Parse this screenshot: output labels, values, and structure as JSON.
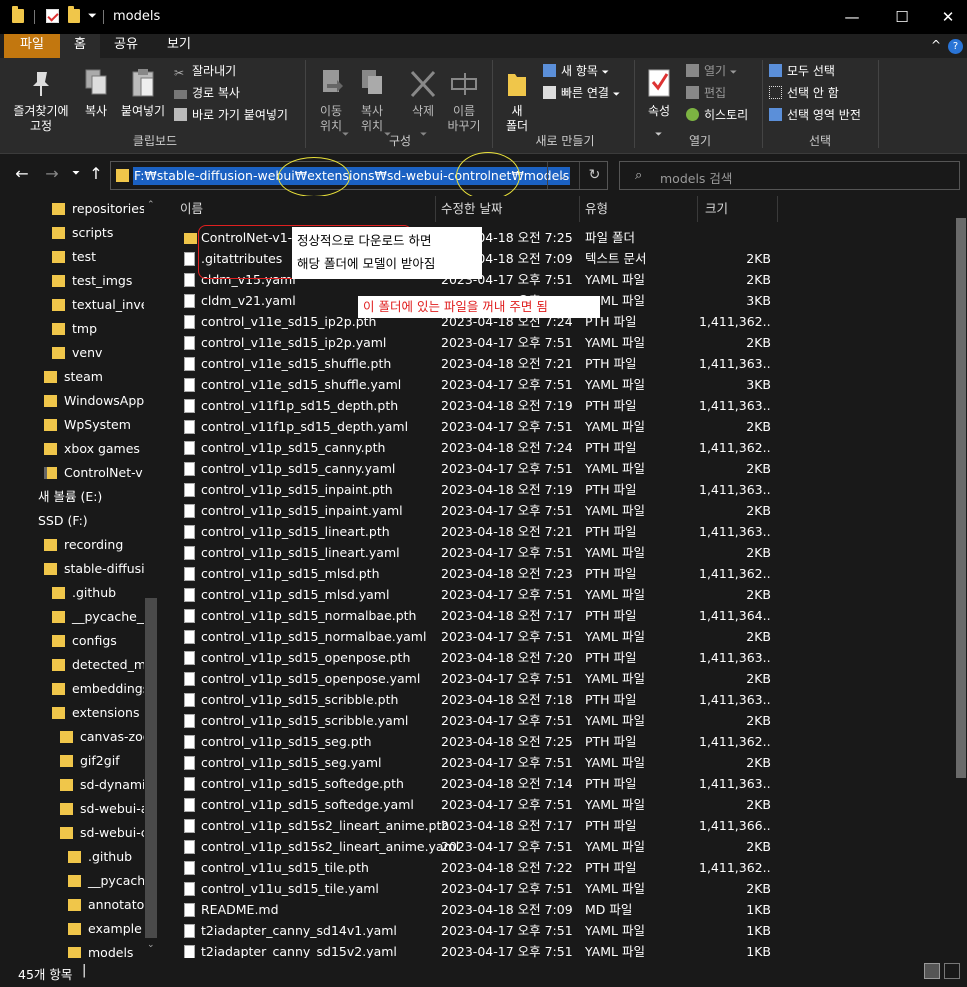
{
  "window": {
    "title": "models",
    "minimize": "—",
    "maximize": "☐",
    "close": "✕"
  },
  "menu": {
    "file": "파일",
    "home": "홈",
    "share": "공유",
    "view": "보기",
    "collapse": "^",
    "help": "?"
  },
  "ribbon": {
    "clipboard": {
      "pin": "즐겨찾기에\n고정",
      "copy": "복사",
      "paste": "붙여넣기",
      "cut": "잘라내기",
      "copy_path": "경로 복사",
      "paste_shortcut": "바로 가기 붙여넣기",
      "label": "클립보드"
    },
    "organize": {
      "move": "이동\n위치",
      "copy_to": "복사\n위치",
      "delete": "삭제",
      "rename": "이름\n바꾸기",
      "label": "구성"
    },
    "new": {
      "new_folder": "새\n폴더",
      "new_item": "새 항목",
      "easy_access": "빠른 연결",
      "label": "새로 만들기"
    },
    "open": {
      "properties": "속성",
      "open": "열기",
      "edit": "편집",
      "history": "히스토리",
      "label": "열기"
    },
    "select": {
      "select_all": "모두 선택",
      "select_none": "선택 안 함",
      "invert": "선택 영역 반전",
      "label": "선택"
    }
  },
  "address": {
    "path": "F:₩stable-diffusion-webui₩extensions₩sd-webui-controlnet₩models",
    "search_placeholder": "models 검색"
  },
  "sidebar": [
    {
      "label": "repositories",
      "icon": "folder-icon"
    },
    {
      "label": "scripts",
      "icon": "folder-icon"
    },
    {
      "label": "test",
      "icon": "folder-icon"
    },
    {
      "label": "test_imgs",
      "icon": "folder-icon"
    },
    {
      "label": "textual_inversion",
      "icon": "folder-icon"
    },
    {
      "label": "tmp",
      "icon": "folder-icon"
    },
    {
      "label": "venv",
      "icon": "folder-icon"
    },
    {
      "label": "steam",
      "icon": "folder-icon"
    },
    {
      "label": "WindowsApps",
      "icon": "folder-icon"
    },
    {
      "label": "WpSystem",
      "icon": "folder-icon"
    },
    {
      "label": "xbox games",
      "icon": "folder-icon"
    },
    {
      "label": "ControlNet-v1-1",
      "icon": "zip-folder-icon"
    },
    {
      "label": "새 볼륨 (E:)",
      "icon": "drive-icon"
    },
    {
      "label": "SSD (F:)",
      "icon": "drive-icon"
    },
    {
      "label": "recording",
      "icon": "folder-icon"
    },
    {
      "label": "stable-diffusion-webui",
      "icon": "folder-icon"
    },
    {
      "label": ".github",
      "icon": "folder-icon"
    },
    {
      "label": "__pycache__",
      "icon": "folder-icon"
    },
    {
      "label": "configs",
      "icon": "folder-icon"
    },
    {
      "label": "detected_maps",
      "icon": "folder-icon"
    },
    {
      "label": "embeddings",
      "icon": "folder-icon"
    },
    {
      "label": "extensions",
      "icon": "folder-icon"
    },
    {
      "label": "canvas-zoom",
      "icon": "folder-icon"
    },
    {
      "label": "gif2gif",
      "icon": "folder-icon"
    },
    {
      "label": "sd-dynamic-prompts",
      "icon": "folder-icon"
    },
    {
      "label": "sd-webui-additional-networks",
      "icon": "folder-icon"
    },
    {
      "label": "sd-webui-controlnet",
      "icon": "folder-icon"
    },
    {
      "label": ".github",
      "icon": "folder-icon"
    },
    {
      "label": "__pycache__",
      "icon": "folder-icon"
    },
    {
      "label": "annotator",
      "icon": "folder-icon"
    },
    {
      "label": "example",
      "icon": "folder-icon"
    },
    {
      "label": "models",
      "icon": "folder-icon"
    }
  ],
  "columns": {
    "name": "이름",
    "date": "수정한 날짜",
    "type": "유형",
    "size": "크기"
  },
  "files": [
    {
      "name": "ControlNet-v1-1",
      "date": "2023-04-18 오전 7:25",
      "type": "파일 폴더",
      "size": "",
      "icon": "folder-icon"
    },
    {
      "name": ".gitattributes",
      "date": "2023-04-18 오전 7:09",
      "type": "텍스트 문서",
      "size": "2KB",
      "icon": "file-icon"
    },
    {
      "name": "cldm_v15.yaml",
      "date": "2023-04-17 오후 7:51",
      "type": "YAML 파일",
      "size": "2KB",
      "icon": "file-icon"
    },
    {
      "name": "cldm_v21.yaml",
      "date": "2023-04-17 오후 7:51",
      "type": "YAML 파일",
      "size": "3KB",
      "icon": "file-icon"
    },
    {
      "name": "control_v11e_sd15_ip2p.pth",
      "date": "2023-04-18 오전 7:24",
      "type": "PTH 파일",
      "size": "1,411,362...",
      "icon": "file-icon"
    },
    {
      "name": "control_v11e_sd15_ip2p.yaml",
      "date": "2023-04-17 오후 7:51",
      "type": "YAML 파일",
      "size": "2KB",
      "icon": "file-icon"
    },
    {
      "name": "control_v11e_sd15_shuffle.pth",
      "date": "2023-04-18 오전 7:21",
      "type": "PTH 파일",
      "size": "1,411,363...",
      "icon": "file-icon"
    },
    {
      "name": "control_v11e_sd15_shuffle.yaml",
      "date": "2023-04-17 오후 7:51",
      "type": "YAML 파일",
      "size": "3KB",
      "icon": "file-icon"
    },
    {
      "name": "control_v11f1p_sd15_depth.pth",
      "date": "2023-04-18 오전 7:19",
      "type": "PTH 파일",
      "size": "1,411,363...",
      "icon": "file-icon"
    },
    {
      "name": "control_v11f1p_sd15_depth.yaml",
      "date": "2023-04-17 오후 7:51",
      "type": "YAML 파일",
      "size": "2KB",
      "icon": "file-icon"
    },
    {
      "name": "control_v11p_sd15_canny.pth",
      "date": "2023-04-18 오전 7:24",
      "type": "PTH 파일",
      "size": "1,411,362...",
      "icon": "file-icon"
    },
    {
      "name": "control_v11p_sd15_canny.yaml",
      "date": "2023-04-17 오후 7:51",
      "type": "YAML 파일",
      "size": "2KB",
      "icon": "file-icon"
    },
    {
      "name": "control_v11p_sd15_inpaint.pth",
      "date": "2023-04-18 오전 7:19",
      "type": "PTH 파일",
      "size": "1,411,363...",
      "icon": "file-icon"
    },
    {
      "name": "control_v11p_sd15_inpaint.yaml",
      "date": "2023-04-17 오후 7:51",
      "type": "YAML 파일",
      "size": "2KB",
      "icon": "file-icon"
    },
    {
      "name": "control_v11p_sd15_lineart.pth",
      "date": "2023-04-18 오전 7:21",
      "type": "PTH 파일",
      "size": "1,411,363...",
      "icon": "file-icon"
    },
    {
      "name": "control_v11p_sd15_lineart.yaml",
      "date": "2023-04-17 오후 7:51",
      "type": "YAML 파일",
      "size": "2KB",
      "icon": "file-icon"
    },
    {
      "name": "control_v11p_sd15_mlsd.pth",
      "date": "2023-04-18 오전 7:23",
      "type": "PTH 파일",
      "size": "1,411,362...",
      "icon": "file-icon"
    },
    {
      "name": "control_v11p_sd15_mlsd.yaml",
      "date": "2023-04-17 오후 7:51",
      "type": "YAML 파일",
      "size": "2KB",
      "icon": "file-icon"
    },
    {
      "name": "control_v11p_sd15_normalbae.pth",
      "date": "2023-04-18 오전 7:17",
      "type": "PTH 파일",
      "size": "1,411,364...",
      "icon": "file-icon"
    },
    {
      "name": "control_v11p_sd15_normalbae.yaml",
      "date": "2023-04-17 오후 7:51",
      "type": "YAML 파일",
      "size": "2KB",
      "icon": "file-icon"
    },
    {
      "name": "control_v11p_sd15_openpose.pth",
      "date": "2023-04-18 오전 7:20",
      "type": "PTH 파일",
      "size": "1,411,363...",
      "icon": "file-icon"
    },
    {
      "name": "control_v11p_sd15_openpose.yaml",
      "date": "2023-04-17 오후 7:51",
      "type": "YAML 파일",
      "size": "2KB",
      "icon": "file-icon"
    },
    {
      "name": "control_v11p_sd15_scribble.pth",
      "date": "2023-04-18 오전 7:18",
      "type": "PTH 파일",
      "size": "1,411,363...",
      "icon": "file-icon"
    },
    {
      "name": "control_v11p_sd15_scribble.yaml",
      "date": "2023-04-17 오후 7:51",
      "type": "YAML 파일",
      "size": "2KB",
      "icon": "file-icon"
    },
    {
      "name": "control_v11p_sd15_seg.pth",
      "date": "2023-04-18 오전 7:25",
      "type": "PTH 파일",
      "size": "1,411,362...",
      "icon": "file-icon"
    },
    {
      "name": "control_v11p_sd15_seg.yaml",
      "date": "2023-04-17 오후 7:51",
      "type": "YAML 파일",
      "size": "2KB",
      "icon": "file-icon"
    },
    {
      "name": "control_v11p_sd15_softedge.pth",
      "date": "2023-04-18 오전 7:14",
      "type": "PTH 파일",
      "size": "1,411,363...",
      "icon": "file-icon"
    },
    {
      "name": "control_v11p_sd15_softedge.yaml",
      "date": "2023-04-17 오후 7:51",
      "type": "YAML 파일",
      "size": "2KB",
      "icon": "file-icon"
    },
    {
      "name": "control_v11p_sd15s2_lineart_anime.pth",
      "date": "2023-04-18 오전 7:17",
      "type": "PTH 파일",
      "size": "1,411,366...",
      "icon": "file-icon"
    },
    {
      "name": "control_v11p_sd15s2_lineart_anime.yaml",
      "date": "2023-04-17 오후 7:51",
      "type": "YAML 파일",
      "size": "2KB",
      "icon": "file-icon"
    },
    {
      "name": "control_v11u_sd15_tile.pth",
      "date": "2023-04-18 오전 7:22",
      "type": "PTH 파일",
      "size": "1,411,362...",
      "icon": "file-icon"
    },
    {
      "name": "control_v11u_sd15_tile.yaml",
      "date": "2023-04-17 오후 7:51",
      "type": "YAML 파일",
      "size": "2KB",
      "icon": "file-icon"
    },
    {
      "name": "README.md",
      "date": "2023-04-18 오전 7:09",
      "type": "MD 파일",
      "size": "1KB",
      "icon": "file-icon"
    },
    {
      "name": "t2iadapter_canny_sd14v1.yaml",
      "date": "2023-04-17 오후 7:51",
      "type": "YAML 파일",
      "size": "1KB",
      "icon": "file-icon"
    },
    {
      "name": "t2iadapter_canny_sd15v2.yaml",
      "date": "2023-04-17 오후 7:51",
      "type": "YAML 파일",
      "size": "1KB",
      "icon": "file-icon"
    }
  ],
  "annotations": {
    "callout1_line1": "정상적으로 다운로드 하면",
    "callout1_line2": "해당 폴더에 모델이 받아짐",
    "callout2": "이 폴더에 있는 파일을 꺼내 주면 됨"
  },
  "status": {
    "item_count": "45개 항목",
    "cursor": "|"
  },
  "colors": {
    "accent_file_tab": "#c2770f",
    "selection": "#1b61c2",
    "folder": "#f0c64a",
    "annotation_red": "#e02020",
    "annotation_yellow": "#e8e03a"
  }
}
